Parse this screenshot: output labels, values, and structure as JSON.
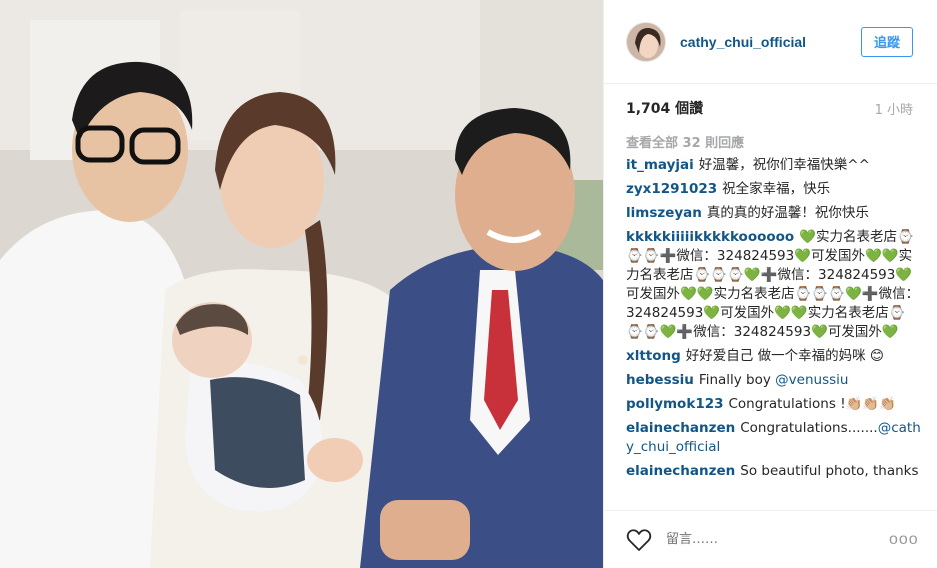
{
  "post": {
    "username": "cathy_chui_official",
    "follow_label": "追蹤",
    "likes": "1,704 個讚",
    "time": "1 小時"
  },
  "comments": {
    "view_all": "查看全部 32 則回應",
    "items": [
      {
        "user": "it_mayjai",
        "text": "好温馨，祝你们幸福快樂^^"
      },
      {
        "user": "zyx1291023",
        "text": "祝全家幸福，快乐"
      },
      {
        "user": "limszeyan",
        "text": "真的真的好温馨！祝你快乐"
      },
      {
        "user": "kkkkkiiiiikkkkkoooooo",
        "text": "💚实力名表老店⌚⌚⌚➕微信：324824593💚可发国外💚💚实力名表老店⌚⌚⌚💚➕微信：324824593💚可发国外💚💚实力名表老店⌚⌚⌚💚➕微信：324824593💚可发国外💚💚实力名表老店⌚⌚⌚💚➕微信：324824593💚可发国外💚"
      },
      {
        "user": "xlttong",
        "text": "好好爱自己 做一个幸福的妈咪 😊"
      },
      {
        "user": "hebessiu",
        "text": "Finally boy ",
        "mention": "@venussiu"
      },
      {
        "user": "pollymok123",
        "text": "Congratulations !👏🏼👏🏼👏🏼"
      },
      {
        "user": "elainechanzen",
        "text": "Congratulations.......",
        "mention": "@cathy_chui_official"
      },
      {
        "user": "elainechanzen",
        "text": "So beautiful photo, thanks"
      }
    ]
  },
  "actions": {
    "comment_placeholder": "留言……",
    "more_label": "ooo",
    "heart_icon": "heart-icon",
    "more_icon": "more-options-icon"
  },
  "colors": {
    "username": "#125688",
    "follow": "#3897f0",
    "muted": "#a5a7aa"
  }
}
